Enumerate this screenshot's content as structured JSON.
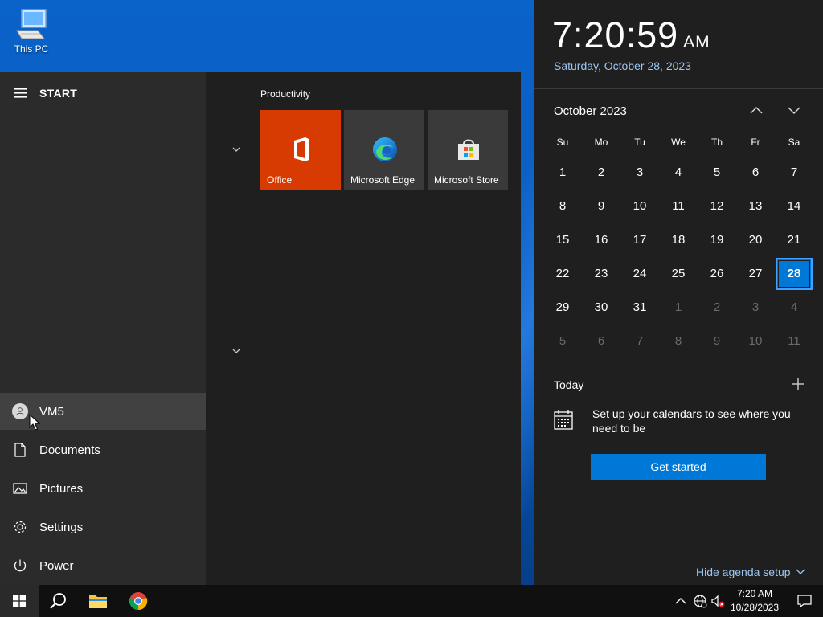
{
  "desktop": {
    "icons": [
      {
        "label": "This PC",
        "icon": "this-pc-icon"
      }
    ]
  },
  "start_menu": {
    "header": "START",
    "user": "VM5",
    "nav": [
      {
        "label": "Documents",
        "icon": "document-icon"
      },
      {
        "label": "Pictures",
        "icon": "pictures-icon"
      },
      {
        "label": "Settings",
        "icon": "gear-icon"
      },
      {
        "label": "Power",
        "icon": "power-icon"
      }
    ],
    "group_title": "Productivity",
    "tiles": [
      {
        "label": "Office",
        "icon": "office-icon",
        "color": "#d83b01"
      },
      {
        "label": "Microsoft Edge",
        "icon": "edge-icon"
      },
      {
        "label": "Microsoft Store",
        "icon": "store-icon"
      }
    ]
  },
  "clock": {
    "time": "7:20:59",
    "ampm": "AM",
    "date": "Saturday, October 28, 2023"
  },
  "calendar": {
    "month": "October 2023",
    "weekdays": [
      "Su",
      "Mo",
      "Tu",
      "We",
      "Th",
      "Fr",
      "Sa"
    ],
    "days": [
      "1",
      "2",
      "3",
      "4",
      "5",
      "6",
      "7",
      "8",
      "9",
      "10",
      "11",
      "12",
      "13",
      "14",
      "15",
      "16",
      "17",
      "18",
      "19",
      "20",
      "21",
      "22",
      "23",
      "24",
      "25",
      "26",
      "27",
      "28",
      "29",
      "30",
      "31",
      "1",
      "2",
      "3",
      "4",
      "5",
      "6",
      "7",
      "8",
      "9",
      "10",
      "11"
    ],
    "current_month_count": 31,
    "selected_day": "28",
    "accent": "#0078d7"
  },
  "agenda": {
    "today_label": "Today",
    "setup_text": "Set up your calendars to see where you need to be",
    "get_started": "Get started",
    "hide_agenda": "Hide agenda setup"
  },
  "taskbar": {
    "clock_time": "7:20 AM",
    "clock_date": "10/28/2023"
  }
}
